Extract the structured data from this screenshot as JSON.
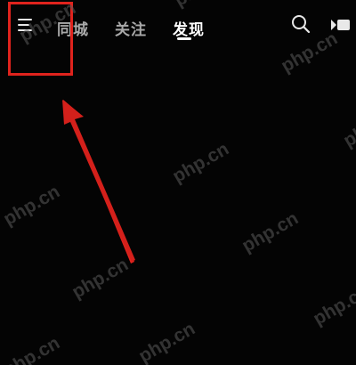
{
  "header": {
    "tabs": [
      {
        "label": "同城",
        "active": false
      },
      {
        "label": "关注",
        "active": false
      },
      {
        "label": "发现",
        "active": true
      }
    ],
    "icons": {
      "menu": "hamburger-menu-icon",
      "search": "search-icon",
      "live": "live-camera-icon"
    }
  },
  "annotation": {
    "box_color": "#e0231d",
    "arrow_color": "#e0231d"
  },
  "watermark": {
    "text": "php.cn"
  },
  "colors": {
    "background": "#040404",
    "tab_active": "#ffffff",
    "tab_inactive": "#a9a9a9"
  }
}
